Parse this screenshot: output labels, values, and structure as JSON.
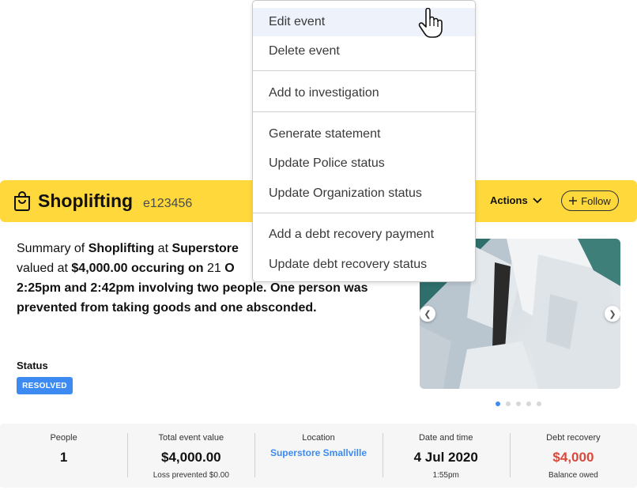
{
  "header": {
    "title": "Shoplifting",
    "event_id": "e123456",
    "actions_label": "Actions",
    "follow_label": "Follow",
    "color": "#FFD93B"
  },
  "summary": {
    "p1": "Summary of ",
    "b1": "Shoplifting",
    "p2": " at ",
    "b2": "Superstore",
    "p3": " valued at ",
    "b3": "$4,000.00 occuring on",
    "p4": " 21 ",
    "b4": "O",
    "line3": "2:25pm and 2:42pm involving two people. One person  was prevented from taking goods and one absconded."
  },
  "status": {
    "label": "Status",
    "badge": "RESOLVED",
    "badge_color": "#3D8BF2"
  },
  "carousel": {
    "prev_icon": "chevron-left-icon",
    "next_icon": "chevron-right-icon",
    "dot_count": 5,
    "active_dot": 0
  },
  "stats": [
    {
      "label": "People",
      "value": "1",
      "sub": ""
    },
    {
      "label": "Total event value",
      "value": "$4,000.00",
      "sub": "Loss prevented $0.00"
    },
    {
      "label": "Location",
      "value": "Superstore Smallville",
      "sub": "",
      "link": true
    },
    {
      "label": "Date and time",
      "value": "4 Jul 2020",
      "sub": "1:55pm"
    },
    {
      "label": "Debt recovery",
      "value": "$4,000",
      "sub": "Balance owed",
      "color": "#D9483B"
    }
  ],
  "menu": {
    "groups": [
      [
        "Edit event",
        "Delete event"
      ],
      [
        "Add to investigation"
      ],
      [
        "Generate statement",
        "Update Police status",
        "Update Organization status"
      ],
      [
        "Add a debt recovery payment",
        "Update debt recovery status"
      ]
    ],
    "hovered": "Edit event"
  }
}
